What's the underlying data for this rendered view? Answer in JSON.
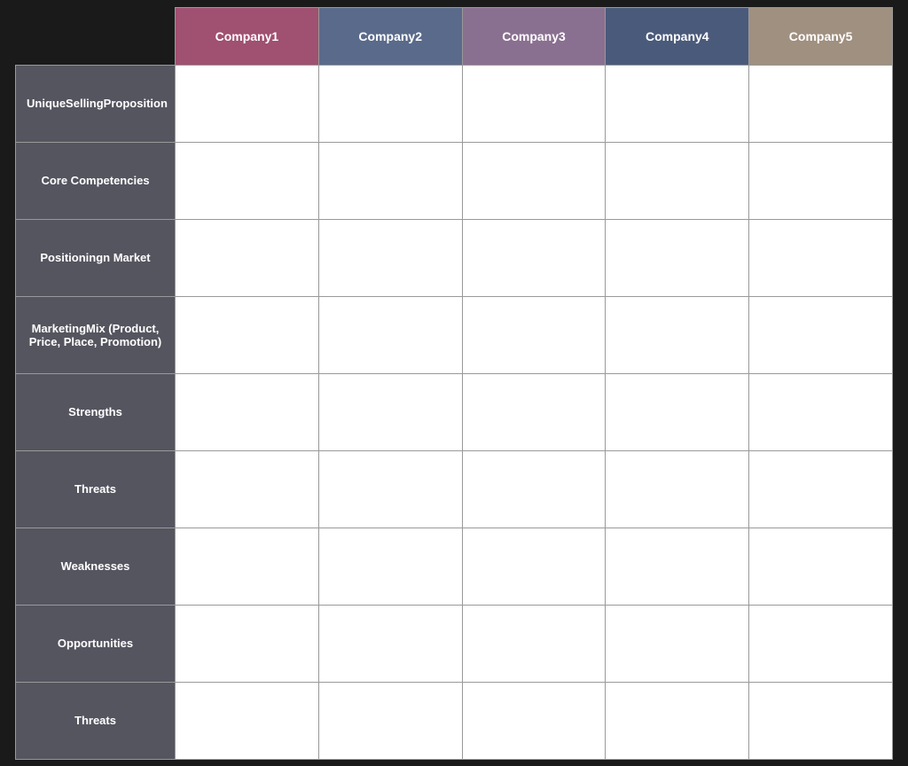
{
  "table": {
    "companies": [
      {
        "id": "company1",
        "label": "Company1",
        "colorClass": "col-company1"
      },
      {
        "id": "company2",
        "label": "Company2",
        "colorClass": "col-company2"
      },
      {
        "id": "company3",
        "label": "Company3",
        "colorClass": "col-company3"
      },
      {
        "id": "company4",
        "label": "Company4",
        "colorClass": "col-company4"
      },
      {
        "id": "company5",
        "label": "Company5",
        "colorClass": "col-company5"
      }
    ],
    "rows": [
      {
        "id": "usp",
        "label": "UniqueSellingProposition",
        "rowClass": "row-usp"
      },
      {
        "id": "core",
        "label": "Core Competencies",
        "rowClass": "row-core"
      },
      {
        "id": "positioning",
        "label": "Positioningn Market",
        "rowClass": "row-positioning"
      },
      {
        "id": "marketing",
        "label": "MarketingMix (Product, Price, Place, Promotion)",
        "rowClass": "row-marketing"
      },
      {
        "id": "strengths",
        "label": "Strengths",
        "rowClass": "row-strengths"
      },
      {
        "id": "threats1",
        "label": "Threats",
        "rowClass": "row-threats1"
      },
      {
        "id": "weaknesses",
        "label": "Weaknesses",
        "rowClass": "row-weaknesses"
      },
      {
        "id": "opportunities",
        "label": "Opportunities",
        "rowClass": "row-opportunities"
      },
      {
        "id": "threats2",
        "label": "Threats",
        "rowClass": "row-threats2"
      }
    ]
  }
}
